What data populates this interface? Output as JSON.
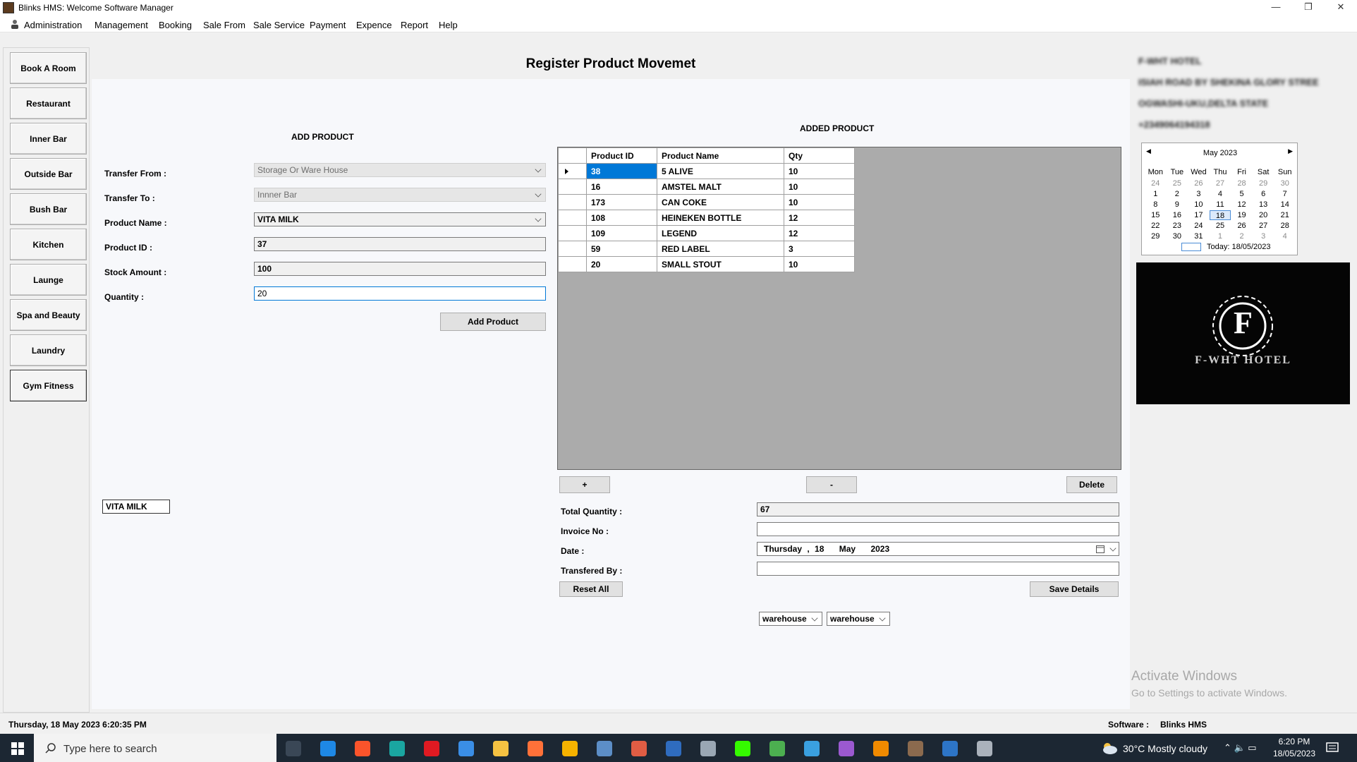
{
  "window": {
    "title": "Blinks HMS: Welcome Software Manager",
    "minimize": "—",
    "restore": "❐",
    "close": "✕"
  },
  "menu": [
    "Administration",
    "Management",
    "Booking",
    "Sale From",
    "Sale Service",
    "Payment",
    "Expence",
    "Report",
    "Help"
  ],
  "sidebar": [
    "Book A Room",
    "Restaurant",
    "Inner Bar",
    "Outside Bar",
    "Bush Bar",
    "Kitchen",
    "Launge",
    "Spa and Beauty",
    "Laundry",
    "Gym  Fitness"
  ],
  "form": {
    "page_title": "Register Product Movemet",
    "add_product_title": "ADD PRODUCT",
    "added_product_title": "ADDED PRODUCT",
    "transfer_from_label": "Transfer From :",
    "transfer_from_value": "Storage Or Ware House",
    "transfer_to_label": "Transfer To :",
    "transfer_to_value": "Innner Bar",
    "product_name_label": "Product Name :",
    "product_name_value": "VITA MILK",
    "product_id_label": "Product ID :",
    "product_id_value": "37",
    "stock_amount_label": "Stock Amount :",
    "stock_amount_value": "100",
    "quantity_label": "Quantity :",
    "quantity_value": "20",
    "add_product_button": "Add Product",
    "side_product_box": "VITA MILK"
  },
  "grid": {
    "columns": [
      "Product ID",
      "Product Name",
      "Qty"
    ],
    "rows": [
      [
        "38",
        "5 ALIVE",
        "10"
      ],
      [
        "16",
        "AMSTEL MALT",
        "10"
      ],
      [
        "173",
        "CAN COKE",
        "10"
      ],
      [
        "108",
        "HEINEKEN BOTTLE",
        "12"
      ],
      [
        "109",
        "LEGEND",
        "12"
      ],
      [
        "59",
        "RED LABEL",
        "3"
      ],
      [
        "20",
        "SMALL STOUT",
        "10"
      ]
    ]
  },
  "actions": {
    "plus": "+",
    "minus": "-",
    "delete": "Delete",
    "total_quantity_label": "Total Quantity :",
    "total_quantity_value": "67",
    "invoice_label": "Invoice No :",
    "invoice_value": "",
    "date_label": "Date :",
    "date_day": "Thursday",
    "date_sep": ",",
    "date_num": "18",
    "date_month": "May",
    "date_year": "2023",
    "transfered_by_label": "Transfered By :",
    "transfered_by_value": "",
    "reset_button": "Reset All",
    "save_button": "Save Details",
    "combo1": "warehouse",
    "combo2": "warehouse"
  },
  "hotel": {
    "name": "F-WHT HOTEL",
    "address1": "ISIAH ROAD BY SHEKINA GLORY STREE",
    "address2": "OGWASHI-UKU,DELTA STATE",
    "phone": "+2349064194318",
    "logo_letter": "F",
    "logo_text": "F-WHT HOTEL"
  },
  "calendar": {
    "month": "May 2023",
    "prev": "◀",
    "next": "▶",
    "weekdays": [
      "Mon",
      "Tue",
      "Wed",
      "Thu",
      "Fri",
      "Sat",
      "Sun"
    ],
    "days": [
      [
        "24",
        "other"
      ],
      [
        "25",
        "other"
      ],
      [
        "26",
        "other"
      ],
      [
        "27",
        "other"
      ],
      [
        "28",
        "other"
      ],
      [
        "29",
        "other"
      ],
      [
        "30",
        "other"
      ],
      [
        "1",
        ""
      ],
      [
        "2",
        ""
      ],
      [
        "3",
        ""
      ],
      [
        "4",
        ""
      ],
      [
        "5",
        ""
      ],
      [
        "6",
        ""
      ],
      [
        "7",
        ""
      ],
      [
        "8",
        ""
      ],
      [
        "9",
        ""
      ],
      [
        "10",
        ""
      ],
      [
        "11",
        ""
      ],
      [
        "12",
        ""
      ],
      [
        "13",
        ""
      ],
      [
        "14",
        ""
      ],
      [
        "15",
        ""
      ],
      [
        "16",
        ""
      ],
      [
        "17",
        ""
      ],
      [
        "18",
        "today"
      ],
      [
        "19",
        ""
      ],
      [
        "20",
        ""
      ],
      [
        "21",
        ""
      ],
      [
        "22",
        ""
      ],
      [
        "23",
        ""
      ],
      [
        "24",
        ""
      ],
      [
        "25",
        ""
      ],
      [
        "26",
        ""
      ],
      [
        "27",
        ""
      ],
      [
        "28",
        ""
      ],
      [
        "29",
        ""
      ],
      [
        "30",
        ""
      ],
      [
        "31",
        ""
      ],
      [
        "1",
        "other"
      ],
      [
        "2",
        "other"
      ],
      [
        "3",
        "other"
      ],
      [
        "4",
        "other"
      ]
    ],
    "today_text": "Today: 18/05/2023"
  },
  "watermark": {
    "line1": "Activate Windows",
    "line2": "Go to Settings to activate Windows."
  },
  "status": {
    "datetime": "Thursday, 18 May 2023 6:20:35 PM",
    "software_label": "Software :",
    "software_value": "Blinks HMS"
  },
  "taskbar": {
    "search_placeholder": "Type here to search",
    "weather": "30°C  Mostly cloudy",
    "time": "6:20 PM",
    "date": "18/05/2023",
    "icons": [
      {
        "name": "task-view-icon",
        "color": "#3a4756"
      },
      {
        "name": "mail-icon",
        "color": "#1e88e5"
      },
      {
        "name": "brave-icon",
        "color": "#fb542b"
      },
      {
        "name": "edge-icon",
        "color": "#1aa6a1"
      },
      {
        "name": "opera-icon",
        "color": "#e01a22"
      },
      {
        "name": "store-icon",
        "color": "#3a8ee6"
      },
      {
        "name": "file-explorer-icon",
        "color": "#f5c242"
      },
      {
        "name": "firefox-icon",
        "color": "#ff7139"
      },
      {
        "name": "app-icon",
        "color": "#f6b300"
      },
      {
        "name": "paint-icon",
        "color": "#5c8ec7"
      },
      {
        "name": "git-icon",
        "color": "#e05d44"
      },
      {
        "name": "powershell-icon",
        "color": "#2f6cbf"
      },
      {
        "name": "app2-icon",
        "color": "#9aa7b4"
      },
      {
        "name": "dreamweaver-icon",
        "color": "#35fa00"
      },
      {
        "name": "chrome-icon",
        "color": "#4caf50"
      },
      {
        "name": "bolt-icon",
        "color": "#3aa0e0"
      },
      {
        "name": "visual-studio-icon",
        "color": "#9b59d0"
      },
      {
        "name": "vlc-icon",
        "color": "#f08a00"
      },
      {
        "name": "blinks-hms-icon",
        "color": "#8b6a4e"
      },
      {
        "name": "photoshop-icon",
        "color": "#2d75c7"
      },
      {
        "name": "database-icon",
        "color": "#aab2bc"
      }
    ]
  }
}
